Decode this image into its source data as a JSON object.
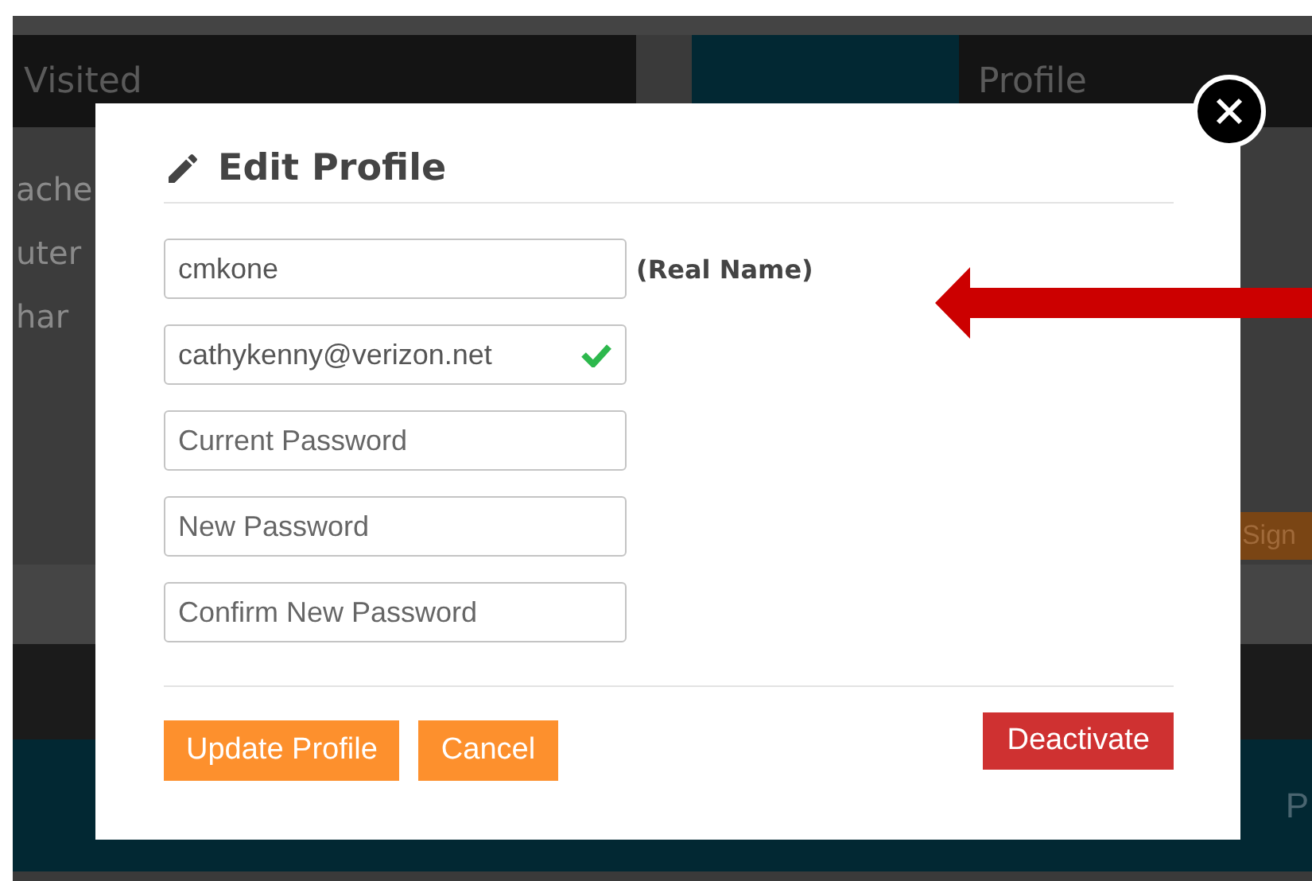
{
  "background": {
    "left_header": "Visited",
    "right_header": "Profile",
    "left_lines": [
      "ache",
      "uter",
      "har"
    ],
    "side_button": "Sign",
    "lower_text": "P"
  },
  "dialog": {
    "title": "Edit Profile",
    "fields": [
      {
        "value": "cmkone",
        "note": "(Real Name)",
        "valid": false
      },
      {
        "value": "cathykenny@verizon.net",
        "valid": true
      },
      {
        "placeholder": "Current Password",
        "valid": false
      },
      {
        "placeholder": "New Password",
        "valid": false
      },
      {
        "placeholder": "Confirm New Password",
        "valid": false
      }
    ],
    "buttons": [
      {
        "label": "Update Profile",
        "kind": "primary"
      },
      {
        "label": "Cancel",
        "kind": "primary"
      },
      {
        "label": "Deactivate",
        "kind": "danger"
      }
    ]
  }
}
